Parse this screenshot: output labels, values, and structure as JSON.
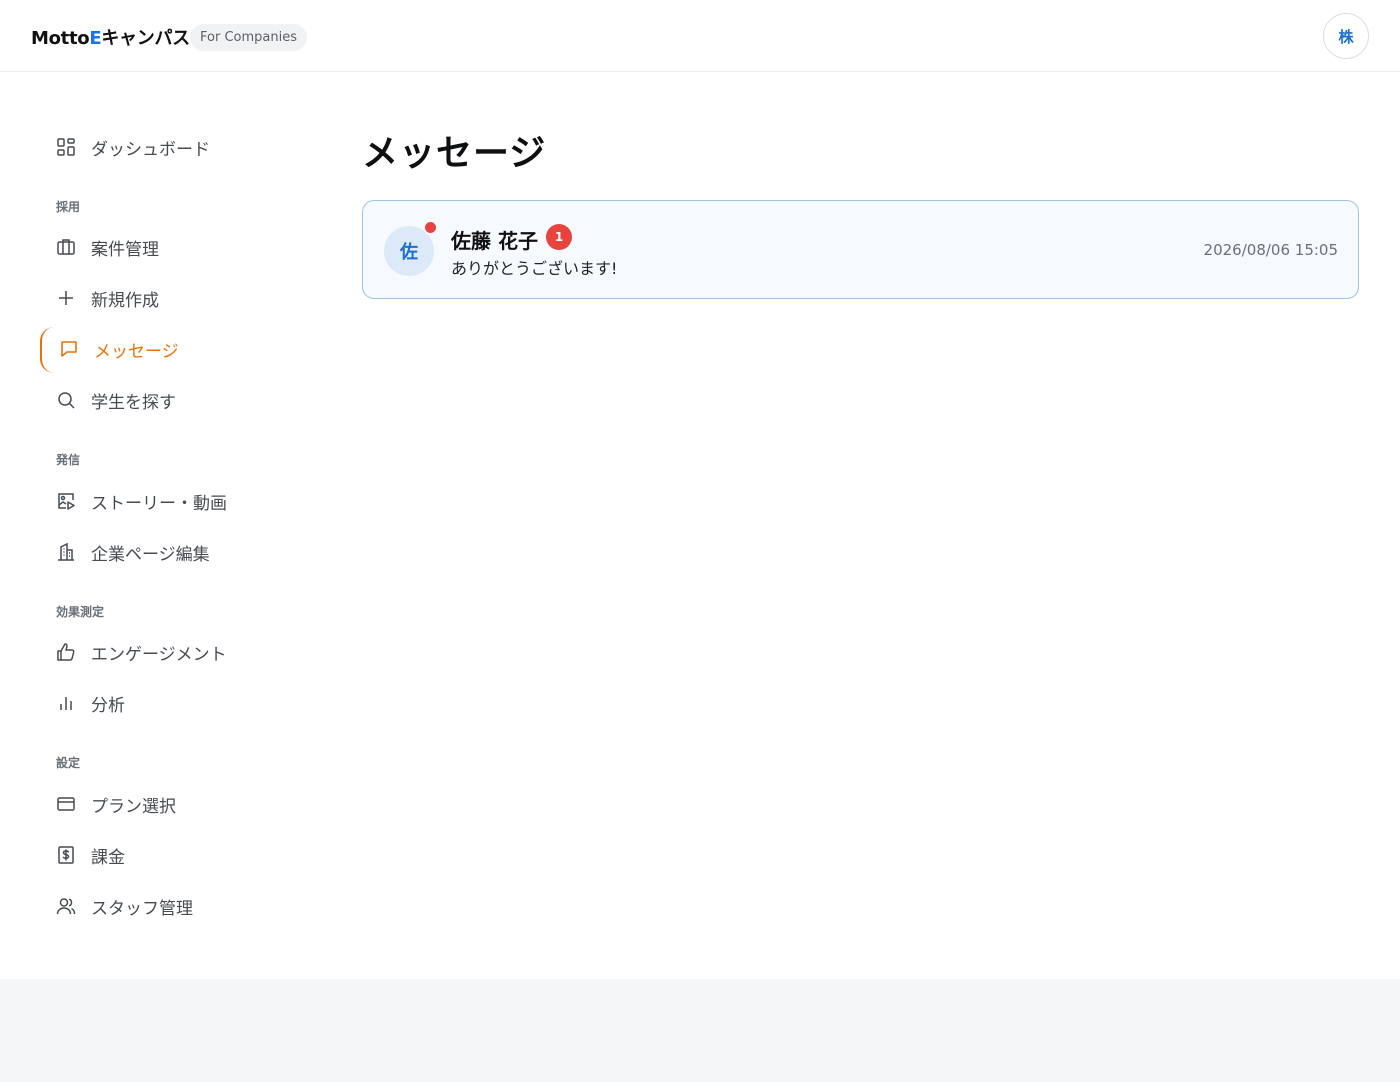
{
  "header": {
    "logo_prefix": "Motto",
    "logo_e": "E",
    "logo_suffix": "キャンパス",
    "badge": "For Companies",
    "account_initial": "株"
  },
  "sidebar": {
    "dashboard": "ダッシュボード",
    "sections": {
      "recruit": "採用",
      "publish": "発信",
      "measure": "効果測定",
      "settings": "設定"
    },
    "items": {
      "jobs": "案件管理",
      "new": "新規作成",
      "messages": "メッセージ",
      "search": "学生を探す",
      "stories": "ストーリー・動画",
      "company_page": "企業ページ編集",
      "engagement": "エンゲージメント",
      "analytics": "分析",
      "plan": "プラン選択",
      "billing": "課金",
      "staff": "スタッフ管理"
    },
    "active_item": "messages",
    "accent_color": "#e8710a"
  },
  "main": {
    "title": "メッセージ",
    "threads": [
      {
        "avatar_initial": "佐",
        "name": "佐藤 花子",
        "unread_count": "1",
        "preview": "ありがとうございます!",
        "timestamp": "2026/08/06 15:05"
      }
    ]
  },
  "colors": {
    "brand_blue": "#1a73e8",
    "unread_red": "#e9433f",
    "card_border": "#9fc4e6"
  }
}
